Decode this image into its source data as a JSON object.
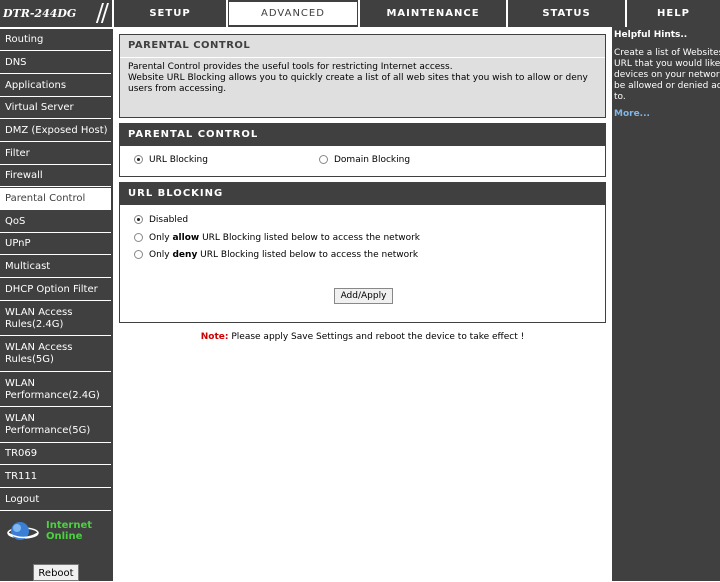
{
  "brand": {
    "model": "DTR-244DG"
  },
  "nav": {
    "tabs": [
      "SETUP",
      "ADVANCED",
      "MAINTENANCE",
      "STATUS",
      "HELP"
    ]
  },
  "sidebar": {
    "items": [
      "Routing",
      "DNS",
      "Applications",
      "Virtual Server",
      "DMZ (Exposed Host)",
      "Filter",
      "Firewall",
      "Parental Control",
      "QoS",
      "UPnP",
      "Multicast",
      "DHCP Option Filter",
      "WLAN Access Rules(2.4G)",
      "WLAN Access Rules(5G)",
      "WLAN Performance(2.4G)",
      "WLAN Performance(5G)",
      "TR069",
      "TR111",
      "Logout"
    ],
    "active_item": "Parental Control",
    "status_line1": "Internet",
    "status_line2": "Online",
    "reboot_label": "Reboot"
  },
  "intro": {
    "title": "PARENTAL CONTROL",
    "line1": "Parental Control provides the useful tools for restricting Internet access.",
    "line2": "Website URL Blocking allows you to quickly create a list of all web sites that you wish to allow or deny users from accessing."
  },
  "mode_section": {
    "title": "PARENTAL CONTROL",
    "options": [
      "URL Blocking",
      "Domain Blocking"
    ],
    "selected": "URL Blocking"
  },
  "url_blocking": {
    "title": "URL BLOCKING",
    "opt_disabled": "Disabled",
    "opt_allow_pre": "Only ",
    "opt_allow_bold": "allow",
    "opt_allow_post": " URL Blocking listed below to access the network",
    "opt_deny_pre": "Only ",
    "opt_deny_bold": "deny",
    "opt_deny_post": " URL Blocking listed below to access the network",
    "selected": "Disabled",
    "apply_label": "Add/Apply"
  },
  "note": {
    "label": "Note:",
    "text": " Please apply Save Settings and reboot the device to take effect !"
  },
  "hints": {
    "title": "Helpful Hints..",
    "lines": [
      "Create a list of Websites",
      "URL that you would like t",
      "devices on your network",
      "be allowed or denied acc",
      "to."
    ],
    "more": "More..."
  },
  "colors": {
    "bar": "#404040",
    "note_label": "#cc0000",
    "status_text": "#4cd140",
    "more_link": "#7db6e8"
  }
}
